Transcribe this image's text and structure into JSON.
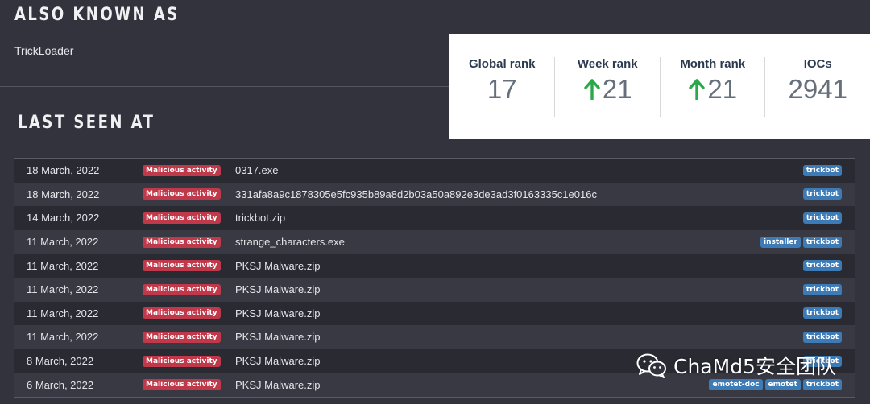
{
  "also_known_as": {
    "title": "ALSO KNOWN AS",
    "value": "TrickLoader"
  },
  "last_seen": {
    "title": "LAST SEEN AT",
    "rows": [
      {
        "date": "18 March, 2022",
        "status": "Malicious activity",
        "name": "0317.exe",
        "tags": [
          "trickbot"
        ]
      },
      {
        "date": "18 March, 2022",
        "status": "Malicious activity",
        "name": "331afa8a9c1878305e5fc935b89a8d2b03a50a892e3de3ad3f0163335c1e016c",
        "tags": [
          "trickbot"
        ]
      },
      {
        "date": "14 March, 2022",
        "status": "Malicious activity",
        "name": "trickbot.zip",
        "tags": [
          "trickbot"
        ]
      },
      {
        "date": "11 March, 2022",
        "status": "Malicious activity",
        "name": "strange_characters.exe",
        "tags": [
          "installer",
          "trickbot"
        ]
      },
      {
        "date": "11 March, 2022",
        "status": "Malicious activity",
        "name": "PKSJ Malware.zip",
        "tags": [
          "trickbot"
        ]
      },
      {
        "date": "11 March, 2022",
        "status": "Malicious activity",
        "name": "PKSJ Malware.zip",
        "tags": [
          "trickbot"
        ]
      },
      {
        "date": "11 March, 2022",
        "status": "Malicious activity",
        "name": "PKSJ Malware.zip",
        "tags": [
          "trickbot"
        ]
      },
      {
        "date": "11 March, 2022",
        "status": "Malicious activity",
        "name": "PKSJ Malware.zip",
        "tags": [
          "trickbot"
        ]
      },
      {
        "date": "8 March, 2022",
        "status": "Malicious activity",
        "name": "PKSJ Malware.zip",
        "tags": [
          "trickbot"
        ]
      },
      {
        "date": "6 March, 2022",
        "status": "Malicious activity",
        "name": "PKSJ Malware.zip",
        "tags": [
          "emotet-doc",
          "emotet",
          "trickbot"
        ]
      }
    ]
  },
  "stats": {
    "global_rank": {
      "label": "Global rank",
      "value": "17"
    },
    "week_rank": {
      "label": "Week rank",
      "value": "21",
      "trend_icon": "arrow-up-icon"
    },
    "month_rank": {
      "label": "Month rank",
      "value": "21",
      "trend_icon": "arrow-up-icon"
    },
    "iocs": {
      "label": "IOCs",
      "value": "2941"
    }
  },
  "colors": {
    "background": "#33333d",
    "malicious_badge": "#c0394a",
    "tag_badge": "#3d7bb6",
    "trend_up": "#2aa84a"
  },
  "watermark": {
    "icon": "wechat-icon",
    "text": "ChaMd5安全团队"
  }
}
